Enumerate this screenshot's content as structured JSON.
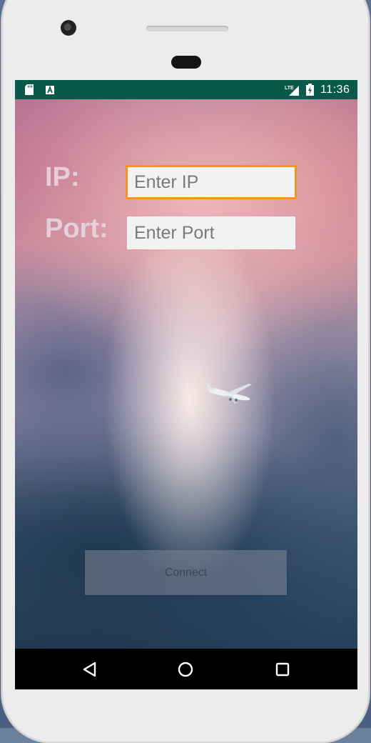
{
  "status_bar": {
    "icons": [
      "sd-card-icon",
      "a-notification-icon",
      "lte-signal-icon",
      "battery-charging-icon"
    ],
    "lte_label": "LTE",
    "time": "11:36",
    "color": "#075a4a"
  },
  "form": {
    "ip_label": "IP:",
    "ip_placeholder": "Enter IP",
    "ip_value": "",
    "port_label": "Port:",
    "port_placeholder": "Enter Port",
    "port_value": "",
    "focus_color": "#f39323"
  },
  "background": {
    "description_icon": "airplane-icon"
  },
  "connect_button": {
    "label": "Connect"
  },
  "nav_bar": {
    "buttons": [
      "back-icon",
      "home-icon",
      "recents-icon"
    ]
  }
}
